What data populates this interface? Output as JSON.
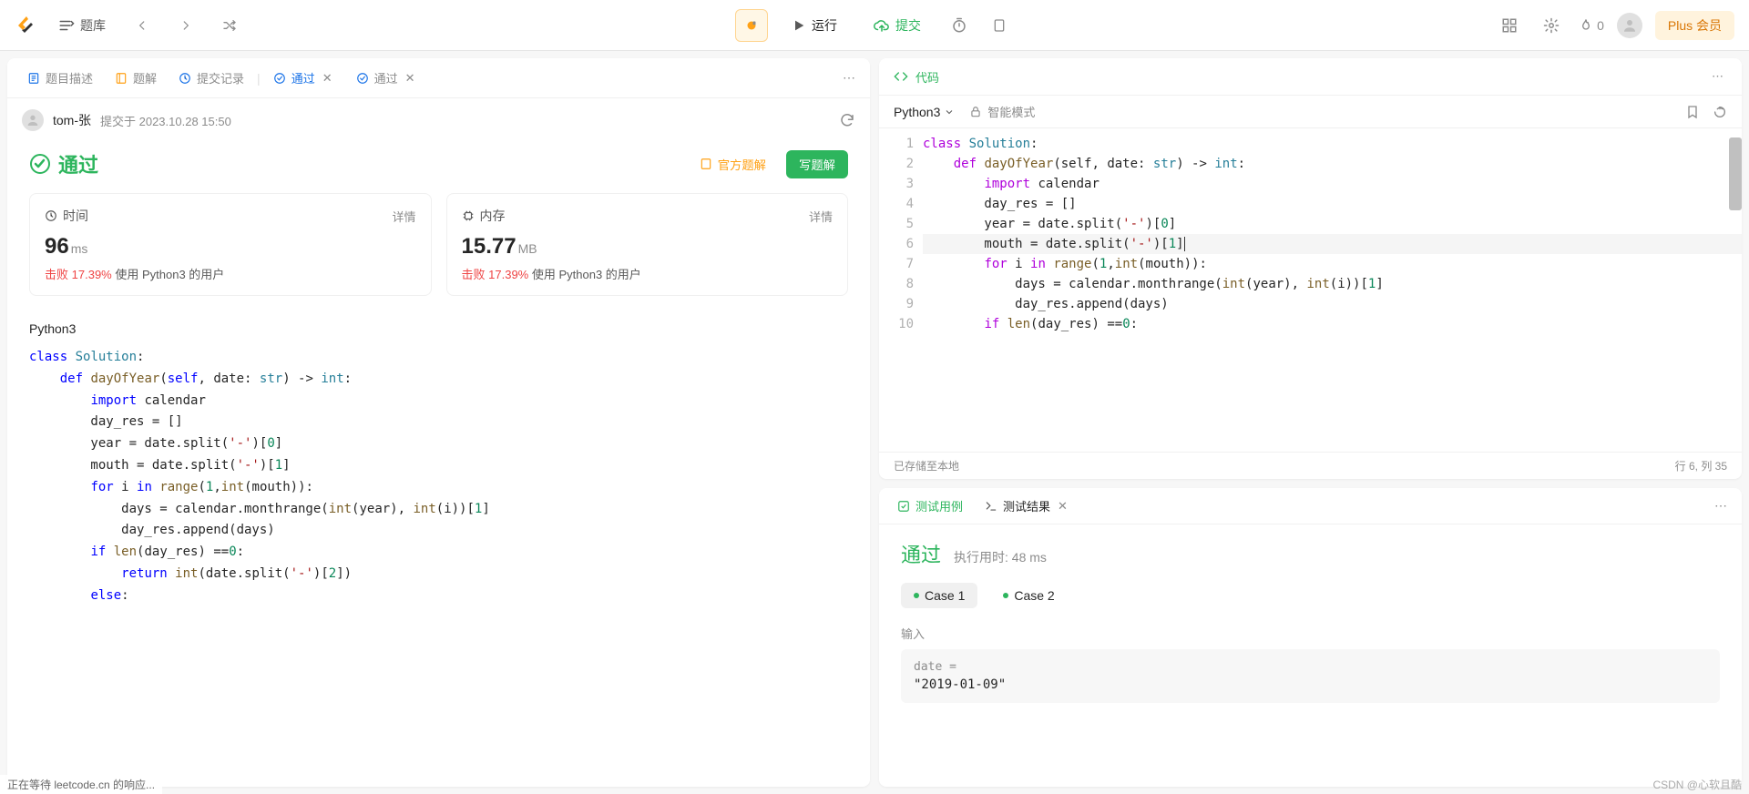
{
  "topbar": {
    "problem_list": "题库",
    "run": "运行",
    "submit": "提交",
    "fire_count": "0",
    "plus": "Plus 会员"
  },
  "left": {
    "tabs": {
      "desc": "题目描述",
      "editorial": "题解",
      "submissions": "提交记录",
      "pass1": "通过",
      "pass2": "通过"
    },
    "user": "tom-张",
    "submitted_at": "提交于 2023.10.28 15:50",
    "status": "通过",
    "official_solution": "官方题解",
    "write_solution": "写题解",
    "time": {
      "label": "时间",
      "detail": "详情",
      "value": "96",
      "unit": "ms",
      "beat_prefix": "击败",
      "beat_pct": "17.39%",
      "beat_suffix": "使用 Python3 的用户"
    },
    "memory": {
      "label": "内存",
      "detail": "详情",
      "value": "15.77",
      "unit": "MB",
      "beat_prefix": "击败",
      "beat_pct": "17.39%",
      "beat_suffix": "使用 Python3 的用户"
    },
    "code_lang": "Python3"
  },
  "editor": {
    "header": "代码",
    "language": "Python3",
    "smart_mode": "智能模式",
    "saved": "已存储至本地",
    "cursor": "行 6,  列 35",
    "lines": [
      "1",
      "2",
      "3",
      "4",
      "5",
      "6",
      "7",
      "8",
      "9",
      "10"
    ]
  },
  "test": {
    "testcase_tab": "测试用例",
    "result_tab": "测试结果",
    "status": "通过",
    "runtime_label": "执行用时: 48 ms",
    "case1": "Case 1",
    "case2": "Case 2",
    "input_label": "输入",
    "input_var": "date =",
    "input_value": "\"2019-01-09\""
  },
  "statusbar": "正在等待 leetcode.cn 的响应...",
  "watermark": "CSDN @心软且酷"
}
